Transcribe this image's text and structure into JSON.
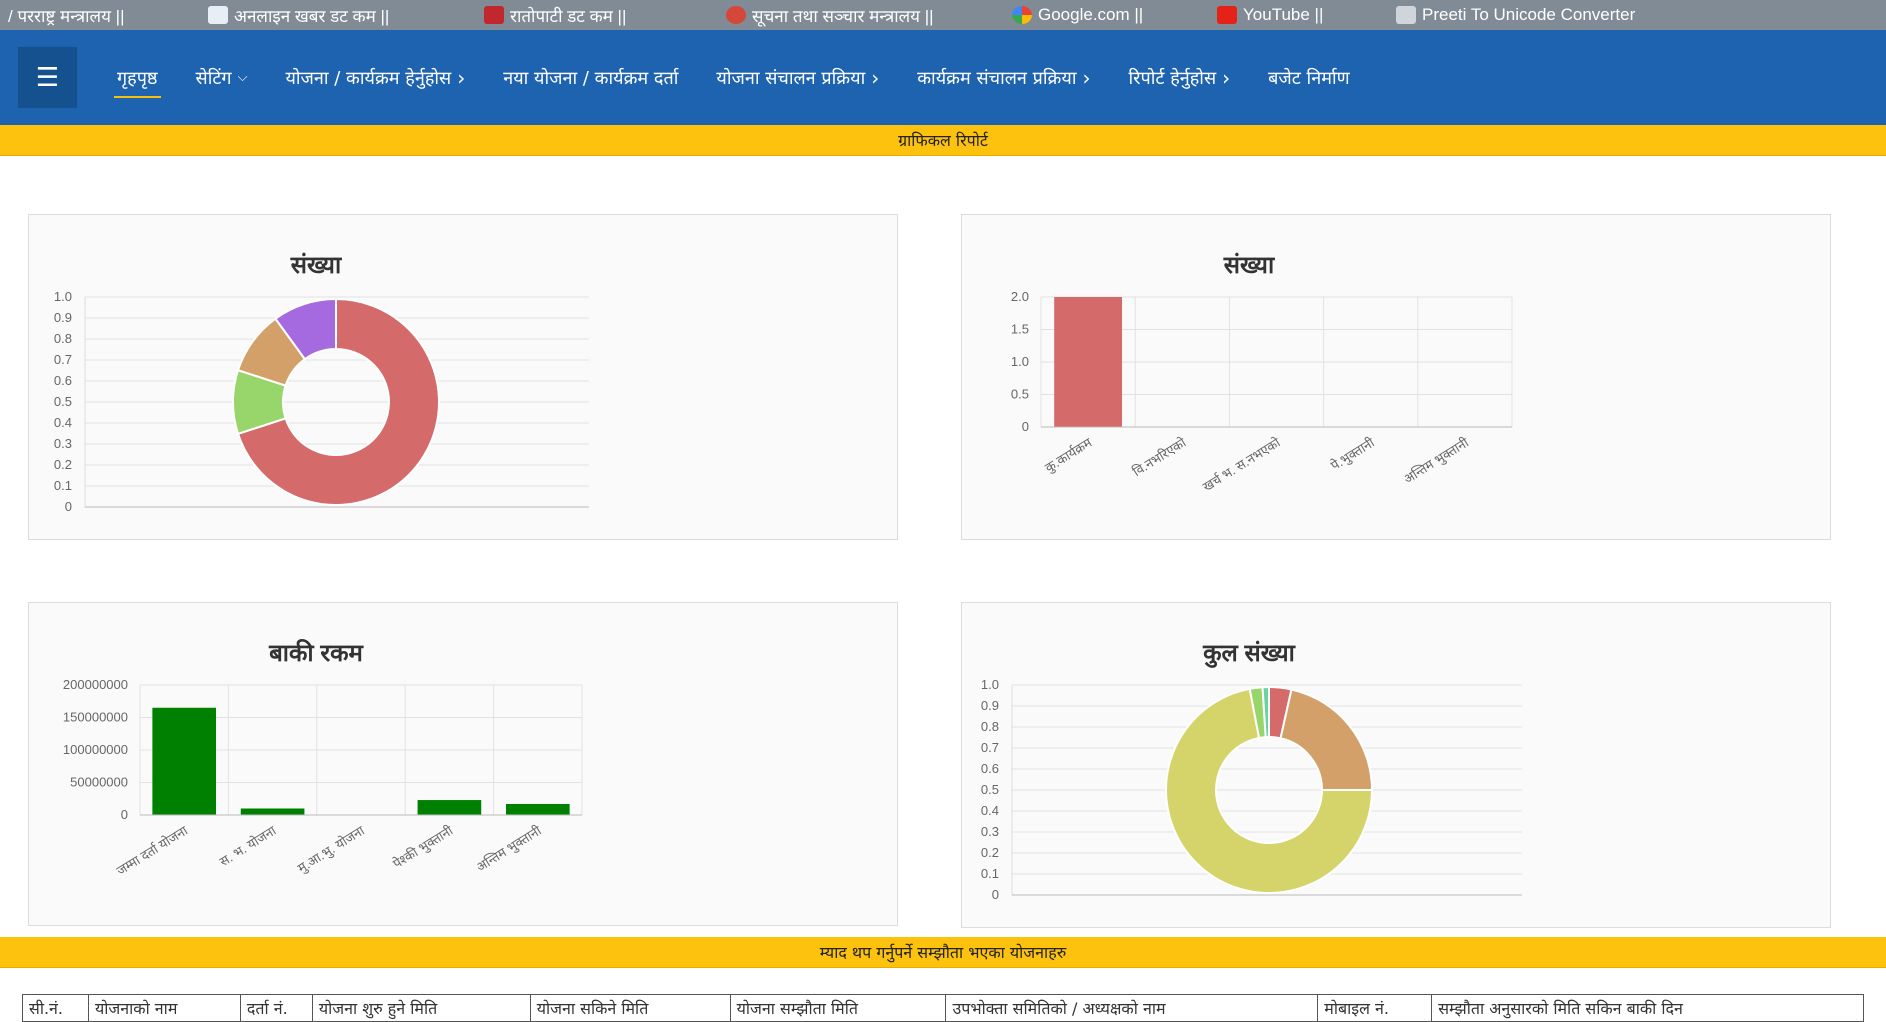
{
  "bookmarks": [
    {
      "label": "/ परराष्ट्र मन्त्रालय ||",
      "icon": "none"
    },
    {
      "label": "अनलाइन खबर डट कम ||",
      "icon": "onlinekhabar-icon",
      "color": "#e8eef5"
    },
    {
      "label": "रातोपाटी डट कम ||",
      "icon": "ratopati-icon",
      "color": "#c0282d"
    },
    {
      "label": "सूचना तथा सञ्चार मन्त्रालय ||",
      "icon": "nepal-emblem-icon",
      "color": "#d6473b"
    },
    {
      "label": "Google.com ||",
      "icon": "google-icon",
      "color": "#4285f4"
    },
    {
      "label": "YouTube ||",
      "icon": "youtube-icon",
      "color": "#e62117"
    },
    {
      "label": "Preeti To Unicode Converter",
      "icon": "preeti-icon",
      "color": "#cfd5db"
    }
  ],
  "nav": {
    "menu_icon": "☰",
    "items": [
      {
        "label": "गृहपृष्ठ",
        "dropdown": false,
        "active": true
      },
      {
        "label": "सेटिंग",
        "dropdown": "down"
      },
      {
        "label": "योजना / कार्यक्रम हेर्नुहोस",
        "dropdown": "right"
      },
      {
        "label": "नया योजना / कार्यक्रम दर्ता",
        "dropdown": false
      },
      {
        "label": "योजना संचालन प्रक्रिया",
        "dropdown": "right"
      },
      {
        "label": "कार्यक्रम संचालन प्रक्रिया",
        "dropdown": "right"
      },
      {
        "label": "रिपोर्ट हेर्नुहोस",
        "dropdown": "right"
      },
      {
        "label": "बजेट निर्माण",
        "dropdown": false
      }
    ]
  },
  "section1_title": "ग्राफिकल रिपोर्ट",
  "section2_title": "म्याद थप गर्नुपर्ने सम्झौता भएका योजनाहरु",
  "colors": {
    "nav_bg": "#1e63b0",
    "section_bg": "#fdc20d",
    "bar_green": "#008000",
    "bar_red": "#d46a6a"
  },
  "chart_data": [
    {
      "type": "doughnut",
      "title": "संख्या",
      "yticks": [
        "1.0",
        "0.9",
        "0.8",
        "0.7",
        "0.6",
        "0.5",
        "0.4",
        "0.3",
        "0.2",
        "0.1",
        "0"
      ],
      "slices": [
        {
          "value": 0.7,
          "color": "#d46a6a"
        },
        {
          "value": 0.1,
          "color": "#98d56a"
        },
        {
          "value": 0.1,
          "color": "#d4a06a"
        },
        {
          "value": 0.1,
          "color": "#a56ae0"
        }
      ]
    },
    {
      "type": "bar",
      "title": "संख्या",
      "categories": [
        "कु.कार्यक्रम",
        "वि.नभरिएको",
        "खर्च भ. स.नभएको",
        "पे.भुक्तानी",
        "अन्तिम भुक्तानी"
      ],
      "values": [
        2,
        0,
        0,
        0,
        0
      ],
      "yticks": [
        "2.0",
        "1.5",
        "1.0",
        "0.5",
        "0"
      ],
      "ylim": [
        0,
        2
      ],
      "color": "#d46a6a"
    },
    {
      "type": "bar",
      "title": "बाकी रकम",
      "categories": [
        "जम्मा दर्ता योजना",
        "स. भ. योजना",
        "मु.आ.भु. योजना",
        "पेश्की भुक्तानी",
        "अन्तिम भुक्तानी"
      ],
      "values": [
        165000000,
        10000000,
        0,
        23000000,
        17000000
      ],
      "yticks": [
        "200000000",
        "150000000",
        "100000000",
        "50000000",
        "0"
      ],
      "ylim": [
        0,
        200000000
      ],
      "color": "#008000"
    },
    {
      "type": "doughnut",
      "title": "कुल संख्या",
      "yticks": [
        "1.0",
        "0.9",
        "0.8",
        "0.7",
        "0.6",
        "0.5",
        "0.4",
        "0.3",
        "0.2",
        "0.1",
        "0"
      ],
      "slices": [
        {
          "value": 0.035,
          "color": "#d46a6a"
        },
        {
          "value": 0.215,
          "color": "#d4a06a"
        },
        {
          "value": 0.72,
          "color": "#d4d46a"
        },
        {
          "value": 0.02,
          "color": "#98d56a"
        },
        {
          "value": 0.01,
          "color": "#6ad4a0"
        }
      ]
    }
  ],
  "table_headers": [
    "सी.नं.",
    "योजनाको नाम",
    "दर्ता नं.",
    "योजना शुरु हुने मिति",
    "योजना सकिने मिति",
    "योजना सम्झौता मिति",
    "उपभोक्ता समितिको / अध्यक्षको नाम",
    "मोबाइल नं.",
    "सम्झौता अनुसारको मिति सकिन बाकी दिन"
  ]
}
